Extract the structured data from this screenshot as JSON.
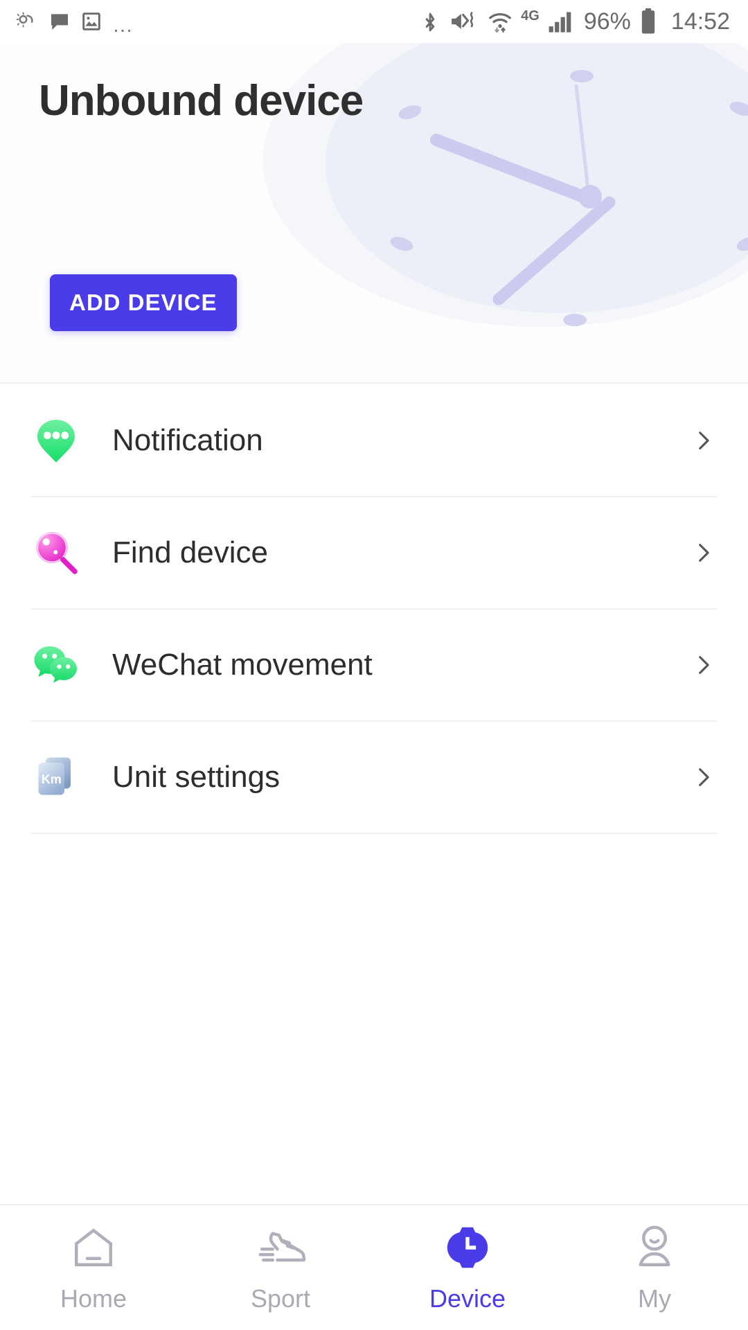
{
  "statusbar": {
    "left_icons": [
      "weather-icon",
      "message-icon",
      "photo-icon",
      "more-icon"
    ],
    "right_icons": [
      "bluetooth-icon",
      "mute-vibrate-icon",
      "wifi-icon",
      "signal-icon",
      "battery-icon"
    ],
    "network_type": "4G",
    "battery_percent": "96%",
    "time": "14:52"
  },
  "header": {
    "title": "Unbound device",
    "add_device_label": "ADD DEVICE",
    "accent_color": "#4a3ce8",
    "illustration": "watch-clock-face-art"
  },
  "list": {
    "items": [
      {
        "label": "Notification",
        "icon": "notification-bubble-icon",
        "chevron": "chevron-right-icon"
      },
      {
        "label": "Find device",
        "icon": "magnifier-icon",
        "chevron": "chevron-right-icon"
      },
      {
        "label": "WeChat movement",
        "icon": "wechat-icon",
        "chevron": "chevron-right-icon"
      },
      {
        "label": "Unit settings",
        "icon": "km-unit-icon",
        "chevron": "chevron-right-icon"
      }
    ]
  },
  "bottomnav": {
    "active_color": "#4a3ce8",
    "inactive_color": "#a9a9b4",
    "items": [
      {
        "label": "Home",
        "icon": "home-icon",
        "active": false
      },
      {
        "label": "Sport",
        "icon": "shoe-icon",
        "active": false
      },
      {
        "label": "Device",
        "icon": "watch-icon",
        "active": true
      },
      {
        "label": "My",
        "icon": "person-icon",
        "active": false
      }
    ]
  }
}
